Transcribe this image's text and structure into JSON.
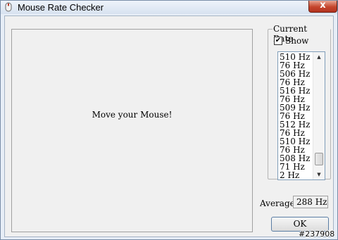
{
  "window": {
    "title": "Mouse Rate Checker",
    "close_glyph": "x"
  },
  "canvas": {
    "message": "Move your Mouse!"
  },
  "current_rate": {
    "legend": "Current Rate",
    "show_label": "Show",
    "show_checked": true,
    "items": [
      "510 Hz",
      "76 Hz",
      "506 Hz",
      "76 Hz",
      "516 Hz",
      "76 Hz",
      "509 Hz",
      "76 Hz",
      "512 Hz",
      "76 Hz",
      "510 Hz",
      "76 Hz",
      "508 Hz",
      "71 Hz",
      "2 Hz"
    ]
  },
  "average": {
    "label": "Average",
    "value": "288 Hz"
  },
  "ok_button": {
    "label": "OK"
  },
  "watermark": "#237908",
  "colors": {
    "close_button": "#c5452c",
    "titlebar": "#d7e2f0",
    "client_bg": "#f0f0f0"
  },
  "icons": {
    "app": "mouse-icon",
    "close": "close-icon",
    "checkbox": "check-icon"
  }
}
